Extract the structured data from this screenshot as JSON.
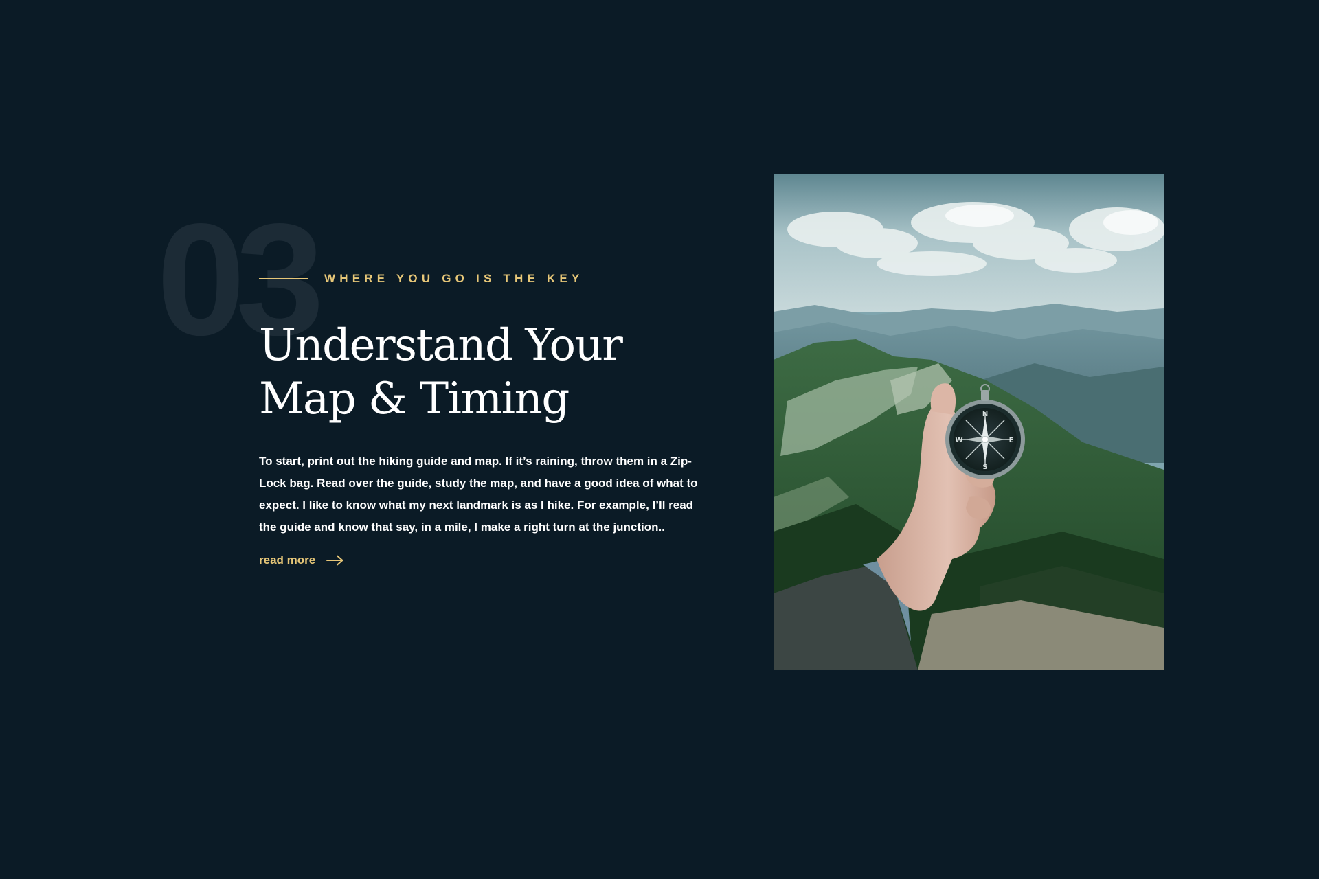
{
  "section": {
    "number": "03",
    "eyebrow": "WHERE YOU GO IS THE KEY",
    "title_line1": "Understand Your",
    "title_line2": "Map & Timing",
    "body": "To start, print out the hiking guide and map. If it’s raining, throw them in a Zip-Lock bag. Read over the guide, study the map, and have a good idea of what to expect. I like to know what my next landmark is as I hike. For example, I’ll read the guide and know that say, in a mile, I make a right turn at the junction..",
    "read_more_label": "read more",
    "read_more_icon": "arrow-right-icon"
  },
  "photo": {
    "subject": "hand-holding-compass-on-mountain-ridge",
    "compass_letters": [
      "N",
      "E",
      "S",
      "W"
    ]
  },
  "colors": {
    "background": "#0b1b26",
    "accent": "#e7c778",
    "number": "#1c2b36",
    "text": "#ffffff"
  }
}
